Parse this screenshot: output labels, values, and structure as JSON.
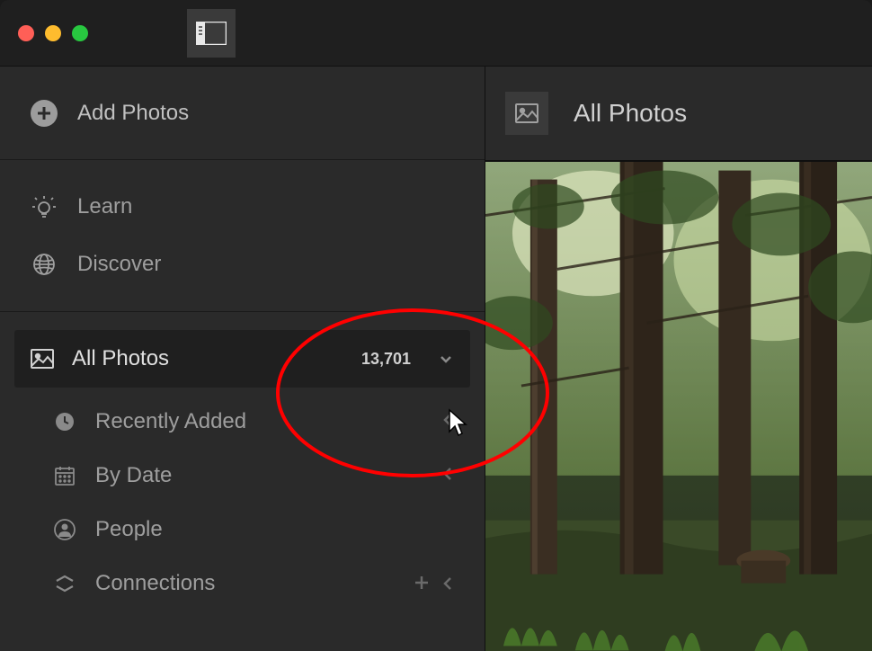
{
  "app": {
    "panel_toggle_icon": "panel-toggle"
  },
  "sidebar": {
    "add_photos_label": "Add Photos",
    "nav": {
      "learn_label": "Learn",
      "discover_label": "Discover"
    },
    "library": {
      "all_photos_label": "All Photos",
      "all_photos_count": "13,701",
      "sub_items": [
        {
          "label": "Recently Added"
        },
        {
          "label": "By Date"
        },
        {
          "label": "People"
        },
        {
          "label": "Connections"
        }
      ]
    }
  },
  "main": {
    "title": "All Photos"
  },
  "annotation": {
    "ellipse_color": "#ff0000"
  }
}
